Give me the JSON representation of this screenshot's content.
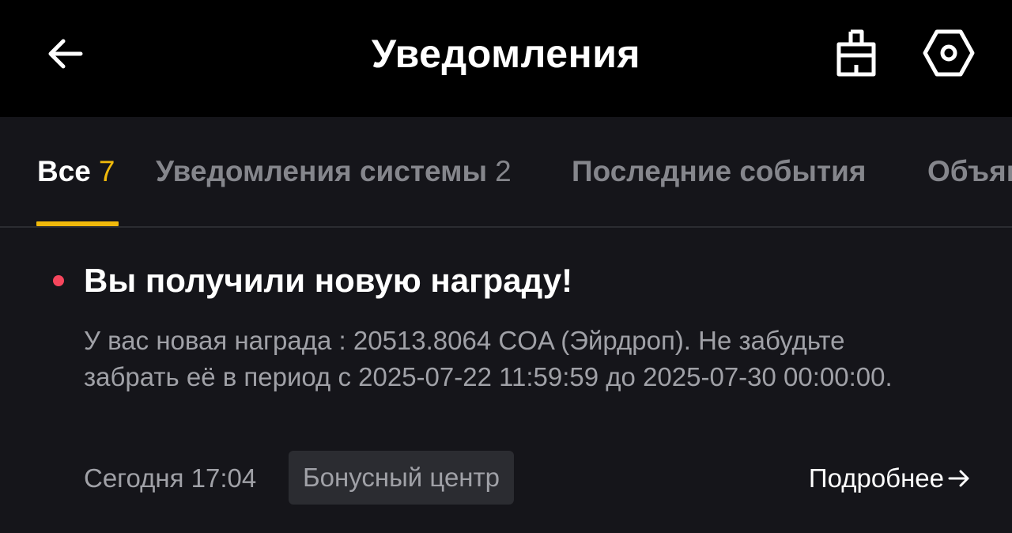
{
  "header": {
    "title": "Уведомления",
    "back_icon": "arrow-left-icon",
    "clean_icon": "broom-icon",
    "settings_icon": "hex-gear-icon"
  },
  "tabs": [
    {
      "label": "Все",
      "count": "7",
      "active": true
    },
    {
      "label": "Уведомления системы",
      "count": "2",
      "active": false
    },
    {
      "label": "Последние события",
      "count": "",
      "active": false
    },
    {
      "label": "Объявления",
      "count": "",
      "active": false
    }
  ],
  "notification": {
    "title": "Вы получили новую награду!",
    "body": "У вас новая награда : 20513.8064 COA (Эйрдроп). Не забудьте забрать её в период с 2025-07-22 11:59:59 до 2025-07-30 00:00:00.",
    "time": "Сегодня 17:04",
    "tag": "Бонусный центр",
    "details_label": "Подробнее",
    "unread": true
  },
  "colors": {
    "accent": "#f0b90b",
    "unread_dot": "#f6465d",
    "background": "#15151a",
    "header_background": "#000000"
  }
}
